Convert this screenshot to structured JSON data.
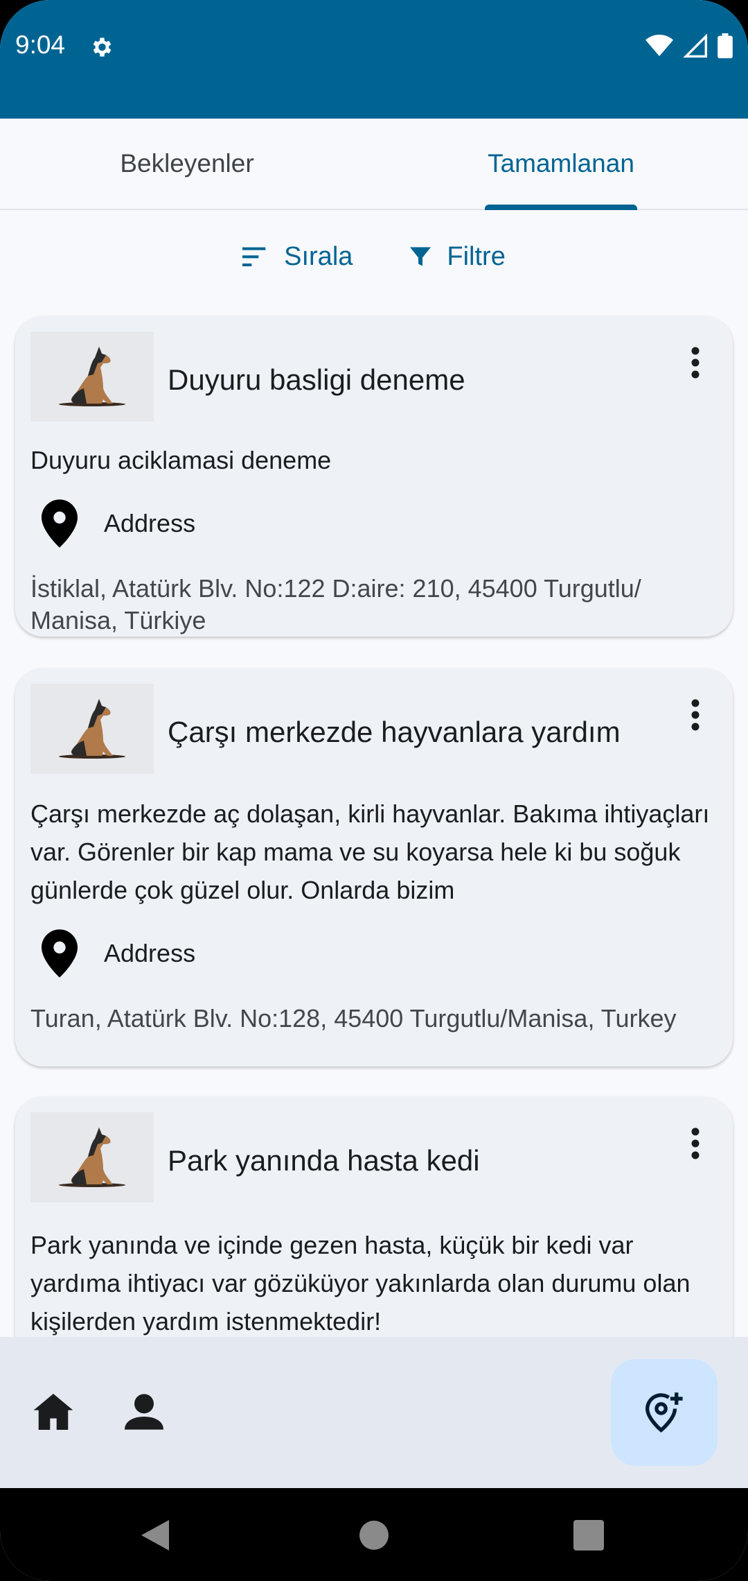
{
  "status": {
    "time": "9:04"
  },
  "tabs": [
    {
      "label": "Bekleyenler"
    },
    {
      "label": "Tamamlanan"
    }
  ],
  "actions": {
    "sort_label": "Sırala",
    "filter_label": "Filtre"
  },
  "cards": [
    {
      "title": "Duyuru basligi deneme",
      "description": "Duyuru aciklamasi deneme",
      "address_label": "Address",
      "address": "İstiklal, Atatürk Blv. No:122 D:aire: 210, 45400 Turgutlu/ Manisa, Türkiye"
    },
    {
      "title": "Çarşı merkezde hayvanlara yardım",
      "description": "Çarşı merkezde aç dolaşan, kirli hayvanlar. Bakıma ihtiyaçları var. Görenler bir kap mama ve su koyarsa hele ki bu soğuk günlerde çok güzel olur. Onlarda bizim",
      "address_label": "Address",
      "address": "Turan, Atatürk Blv. No:128, 45400 Turgutlu/Manisa, Turkey"
    },
    {
      "title": "Park yanında hasta kedi",
      "description": "Park yanında ve içinde gezen hasta, küçük bir kedi var yardıma ihtiyacı var gözüküyor yakınlarda olan durumu olan kişilerden yardım istenmektedir!"
    }
  ],
  "colors": {
    "primary": "#006493",
    "fab": "#cde5ff"
  },
  "icons": {
    "sort": "sort-icon",
    "filter": "filter-icon",
    "location": "location-pin-icon",
    "home": "home-icon",
    "profile": "person-icon",
    "add_location": "add-location-icon"
  }
}
